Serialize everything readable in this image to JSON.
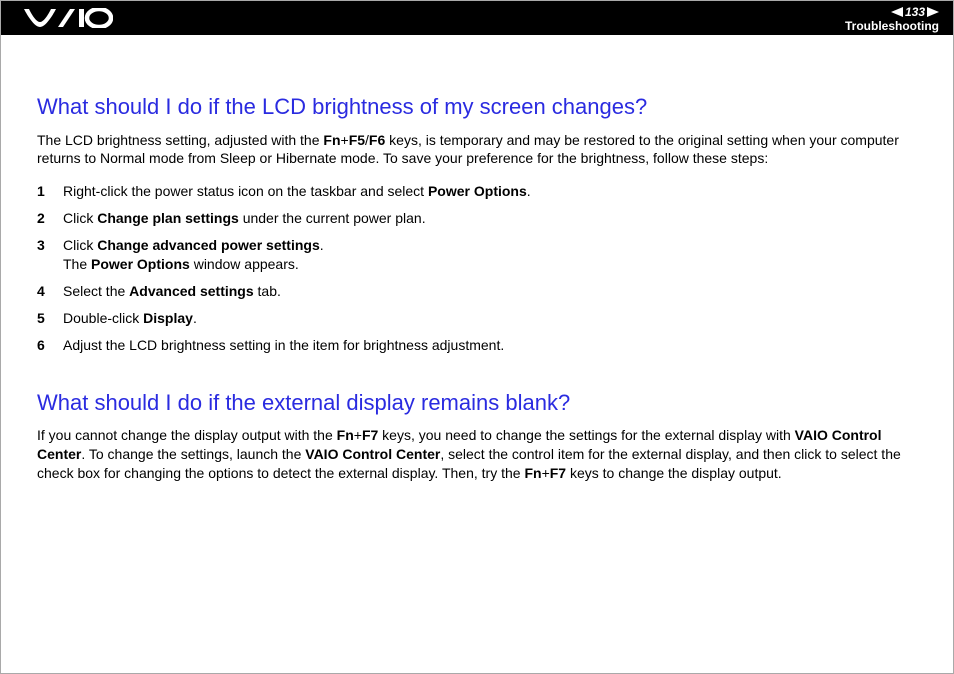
{
  "header": {
    "page_number": "133",
    "section": "Troubleshooting"
  },
  "content": {
    "q1": {
      "title": "What should I do if the LCD brightness of my screen changes?",
      "intro_pre": "The LCD brightness setting, adjusted with the ",
      "intro_keys": "Fn",
      "intro_plus1": "+",
      "intro_keys2": "F5",
      "intro_slash": "/",
      "intro_keys3": "F6",
      "intro_post": " keys, is temporary and may be restored to the original setting when your computer returns to Normal mode from Sleep or Hibernate mode. To save your preference for the brightness, follow these steps:",
      "steps": {
        "s1_pre": "Right-click the power status icon on the taskbar and select ",
        "s1_b": "Power Options",
        "s1_post": ".",
        "s2_pre": "Click ",
        "s2_b": "Change plan settings",
        "s2_post": " under the current power plan.",
        "s3_pre": "Click ",
        "s3_b": "Change advanced power settings",
        "s3_post": ".",
        "s3_line2_pre": "The ",
        "s3_line2_b": "Power Options",
        "s3_line2_post": " window appears.",
        "s4_pre": "Select the ",
        "s4_b": "Advanced settings",
        "s4_post": " tab.",
        "s5_pre": "Double-click ",
        "s5_b": "Display",
        "s5_post": ".",
        "s6": "Adjust the LCD brightness setting in the item for brightness adjustment."
      }
    },
    "q2": {
      "title": "What should I do if the external display remains blank?",
      "p_pre": "If you cannot change the display output with the ",
      "p_k1": "Fn",
      "p_plus1": "+",
      "p_k2": "F7",
      "p_mid1": " keys, you need to change the settings for the external display with ",
      "p_b1": "VAIO Control Center",
      "p_mid2": ". To change the settings, launch the ",
      "p_b2": "VAIO Control Center",
      "p_mid3": ", select the control item for the external display, and then click to select the check box for changing the options to detect the external display. Then, try the ",
      "p_k3": "Fn",
      "p_plus2": "+",
      "p_k4": "F7",
      "p_post": " keys to change the display output."
    }
  }
}
